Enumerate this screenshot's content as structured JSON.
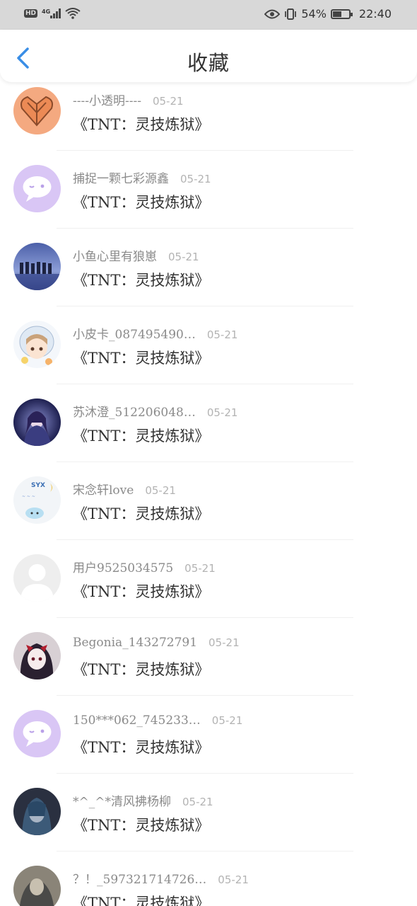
{
  "status_bar": {
    "hd": "HD",
    "network": "4G",
    "battery_text": "54%",
    "battery_level": 0.54,
    "time": "22:40"
  },
  "header": {
    "title": "收藏",
    "back_icon": "chevron-left-icon",
    "accent": "#3a8ee6"
  },
  "items": [
    {
      "username": "----小透明----",
      "date": "05-21",
      "title": "《TNT：灵技炼狱》",
      "avatar": "orange-heart"
    },
    {
      "username": "捕捉一颗七彩源鑫",
      "date": "05-21",
      "title": "《TNT：灵技炼狱》",
      "avatar": "purple-chat"
    },
    {
      "username": "小鱼心里有狼崽",
      "date": "05-21",
      "title": "《TNT：灵技炼狱》",
      "avatar": "group-silhouette"
    },
    {
      "username": "小皮卡_087495490…",
      "date": "05-21",
      "title": "《TNT：灵技炼狱》",
      "avatar": "anime-girl-hood"
    },
    {
      "username": "苏沐澄_512206048…",
      "date": "05-21",
      "title": "《TNT：灵技炼狱》",
      "avatar": "anime-dark"
    },
    {
      "username": "宋念轩love",
      "date": "05-21",
      "title": "《TNT：灵技炼狱》",
      "avatar": "syx-sticker"
    },
    {
      "username": "用户9525034575",
      "date": "05-21",
      "title": "《TNT：灵技炼狱》",
      "avatar": "default-user"
    },
    {
      "username": "Begonia_143272791",
      "date": "05-21",
      "title": "《TNT：灵技炼狱》",
      "avatar": "anime-red-bow"
    },
    {
      "username": "150***062_745233…",
      "date": "05-21",
      "title": "《TNT：灵技炼狱》",
      "avatar": "purple-chat"
    },
    {
      "username": "*^_^*清风拂杨柳",
      "date": "05-21",
      "title": "《TNT：灵技炼狱》",
      "avatar": "anime-blue-hair"
    },
    {
      "username": "？！_597321714726…",
      "date": "05-21",
      "title": "《TNT：灵技炼狱》",
      "avatar": "photo-dark"
    }
  ]
}
